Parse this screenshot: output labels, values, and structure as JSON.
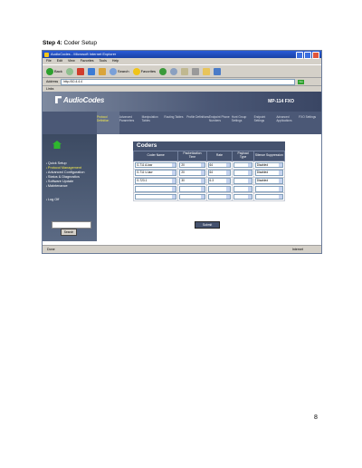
{
  "step": {
    "prefix": "Step 4:",
    "text": " Coder Setup"
  },
  "browser": {
    "title": "AudioCodes - Microsoft Internet Explorer",
    "menu": [
      "File",
      "Edit",
      "View",
      "Favorites",
      "Tools",
      "Help"
    ],
    "toolbar": {
      "back": "Back",
      "search": "Search",
      "favorites": "Favorites"
    },
    "address_label": "Address",
    "address_value": "http://10.4.4.4",
    "go": "Go",
    "links": "Links",
    "status_left": "Done",
    "status_right": "Internet"
  },
  "banner": {
    "logo": "AudioCodes",
    "model": "MP-114 FXO"
  },
  "nav_tabs": [
    "Protocol Definition",
    "Advanced Parameters",
    "Manipulation Tables",
    "Routing Tables",
    "Profile Definitions",
    "Endpoint Phone Numbers",
    "Hunt Group Settings",
    "Endpoint Settings",
    "Advanced Applications",
    "FXO Settings"
  ],
  "sidebar_menu": [
    "Quick Setup",
    "Protocol Management",
    "Advanced Configuration",
    "Status & Diagnostics",
    "Software Update",
    "Maintenance"
  ],
  "sidebar_logoff": "Log Off",
  "sidebar_button": "Search",
  "coders": {
    "title": "Coders",
    "headers": [
      "Coder Name",
      "Packetization Time",
      "Rate",
      "Payload Type",
      "Silence Suppression"
    ],
    "rows": [
      [
        "G.711 A-law",
        "20",
        "64",
        "",
        "Disabled"
      ],
      [
        "G.711 U-law",
        "20",
        "64",
        "",
        "Disabled"
      ],
      [
        "G.723.1",
        "30",
        "6.3",
        "",
        "Disabled"
      ],
      [
        "",
        "",
        "",
        "",
        ""
      ],
      [
        "",
        "",
        "",
        "",
        ""
      ]
    ],
    "submit": "Submit"
  },
  "page_number": "8"
}
